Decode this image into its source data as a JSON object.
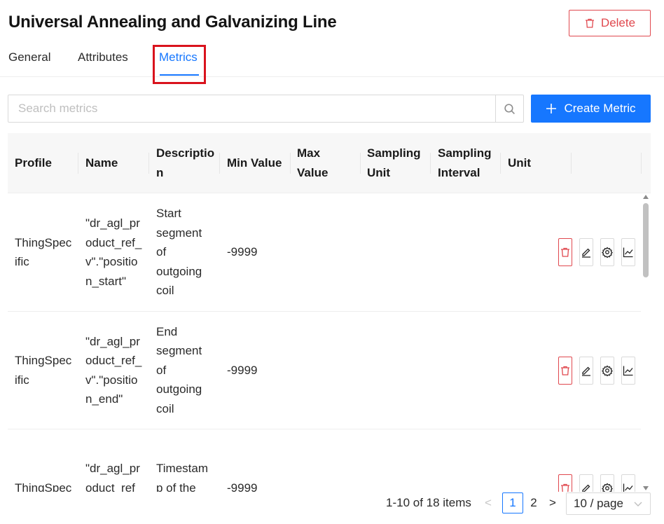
{
  "header": {
    "title": "Universal Annealing and Galvanizing Line",
    "delete_label": "Delete",
    "delete_icon": "trash-icon"
  },
  "tabs": [
    {
      "label": "General",
      "active": false
    },
    {
      "label": "Attributes",
      "active": false
    },
    {
      "label": "Metrics",
      "active": true
    }
  ],
  "search": {
    "placeholder": "Search metrics",
    "value": "",
    "icon": "search-icon"
  },
  "create_button": {
    "label": "Create Metric",
    "icon": "plus-icon"
  },
  "table": {
    "columns": [
      "Profile",
      "Name",
      "Descriptio\nn",
      "Min Value",
      "Max\nValue",
      "Sampling\nUnit",
      "Sampling\nInterval",
      "Unit"
    ],
    "rows": [
      {
        "profile": "ThingSpec\nific",
        "name": "\"dr_agl_pr\noduct_ref_\nv\".\"positio\nn_start\"",
        "description": "Start\nsegment\nof\noutgoing\ncoil",
        "min_value": "-9999",
        "max_value": "",
        "sampling_unit": "",
        "sampling_interval": "",
        "unit": ""
      },
      {
        "profile": "ThingSpec\nific",
        "name": "\"dr_agl_pr\noduct_ref_\nv\".\"positio\nn_end\"",
        "description": "End\nsegment\nof\noutgoing\ncoil",
        "min_value": "-9999",
        "max_value": "",
        "sampling_unit": "",
        "sampling_interval": "",
        "unit": ""
      },
      {
        "profile": "ThingSpec",
        "name": "\"dr_agl_pr\noduct_ref_\nv\".\"last_m",
        "description": "Timestam\np of the\nlast",
        "min_value": "-9999",
        "max_value": "",
        "sampling_unit": "",
        "sampling_interval": "",
        "unit": ""
      }
    ],
    "row_actions": [
      "trash-icon",
      "edit-icon",
      "settings-icon",
      "line-chart-icon"
    ]
  },
  "pagination": {
    "total_label": "1-10 of 18 items",
    "pages": [
      "1",
      "2"
    ],
    "current_page": "1",
    "prev_symbol": "<",
    "next_symbol": ">",
    "page_size": "10 / page"
  },
  "colors": {
    "primary": "#1677ff",
    "danger": "#e0484e",
    "highlight": "#d9131d"
  }
}
